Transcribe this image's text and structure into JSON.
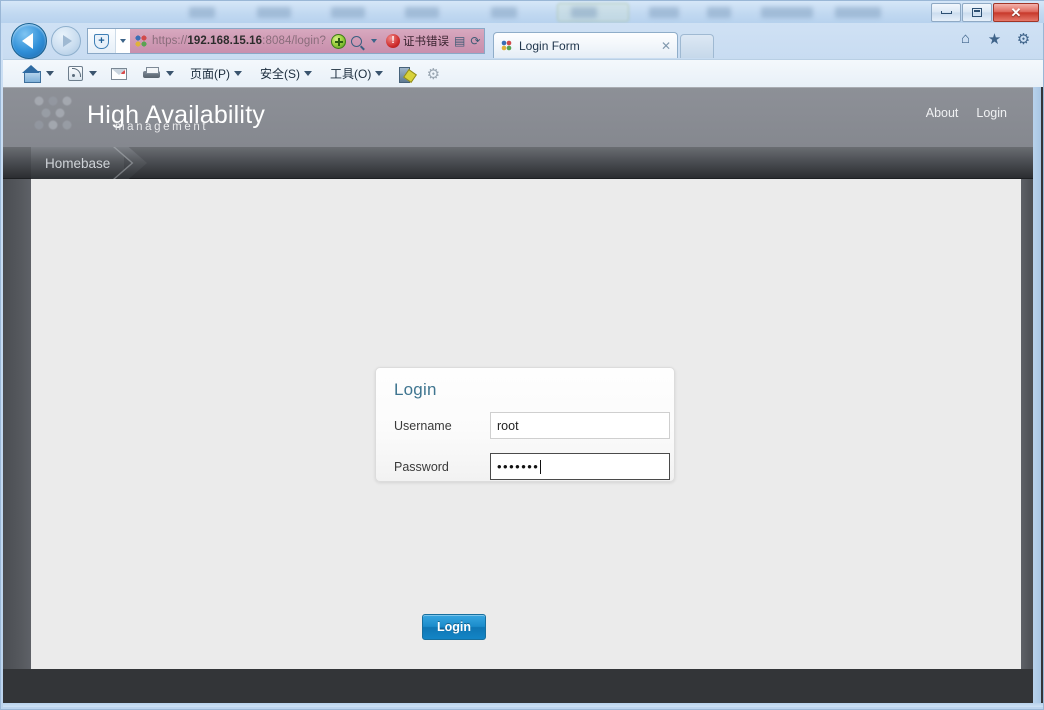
{
  "window": {
    "controls": {
      "minimize": "—",
      "maximize": "□",
      "close": "✕"
    }
  },
  "browser": {
    "nav": {
      "back_label": "◀",
      "forward_label": "▶"
    },
    "address_bar": {
      "protocol": "https://",
      "host": "192.168.15.16",
      "path": ":8084/login?",
      "full_url": "https://192.168.15.16:8084/login?",
      "security_status": "证书错误",
      "shield_label": "+",
      "compat_view_title": "compatibility-view",
      "search_title": "search",
      "stop_label": "✕",
      "refresh_label": "⟳",
      "page_icon_label": "▤"
    },
    "tabs": [
      {
        "title": "Login Form",
        "close_label": "✕"
      }
    ],
    "new_tab_label": "",
    "right_icons": [
      {
        "name": "home-icon",
        "glyph": "⌂"
      },
      {
        "name": "favorites-star-icon",
        "glyph": "★"
      },
      {
        "name": "tools-gear-icon",
        "glyph": "⚙"
      }
    ],
    "command_bar": [
      {
        "name": "home",
        "label": "",
        "has_caret": true
      },
      {
        "name": "feeds",
        "label": "",
        "has_caret": true
      },
      {
        "name": "read-mail",
        "label": "",
        "has_caret": false
      },
      {
        "name": "print",
        "label": "",
        "has_caret": true
      },
      {
        "name": "page-menu",
        "label": "页面(P)",
        "has_caret": true
      },
      {
        "name": "safety-menu",
        "label": "安全(S)",
        "has_caret": true
      },
      {
        "name": "tools-menu",
        "label": "工具(O)",
        "has_caret": true
      },
      {
        "name": "developer-tools",
        "label": "",
        "has_caret": false
      },
      {
        "name": "settings-gear",
        "label": "",
        "has_caret": false
      }
    ]
  },
  "page": {
    "header": {
      "brand_title": "High Availability",
      "brand_subtitle": "management",
      "links": [
        {
          "label": "About"
        },
        {
          "label": "Login"
        }
      ]
    },
    "breadcrumb": {
      "current": "Homebase"
    },
    "login_form": {
      "heading": "Login",
      "username_label": "Username",
      "username_value": "root",
      "username_placeholder": "",
      "password_label": "Password",
      "password_value": "•••••••",
      "password_placeholder": "",
      "submit_label": "Login"
    },
    "colors": {
      "accent_blue": "#1b8ccb",
      "heading_blue": "#3f7590",
      "header_gray": "#8a8d94",
      "content_bg": "#ebebeb",
      "page_bg": "#333538"
    }
  }
}
